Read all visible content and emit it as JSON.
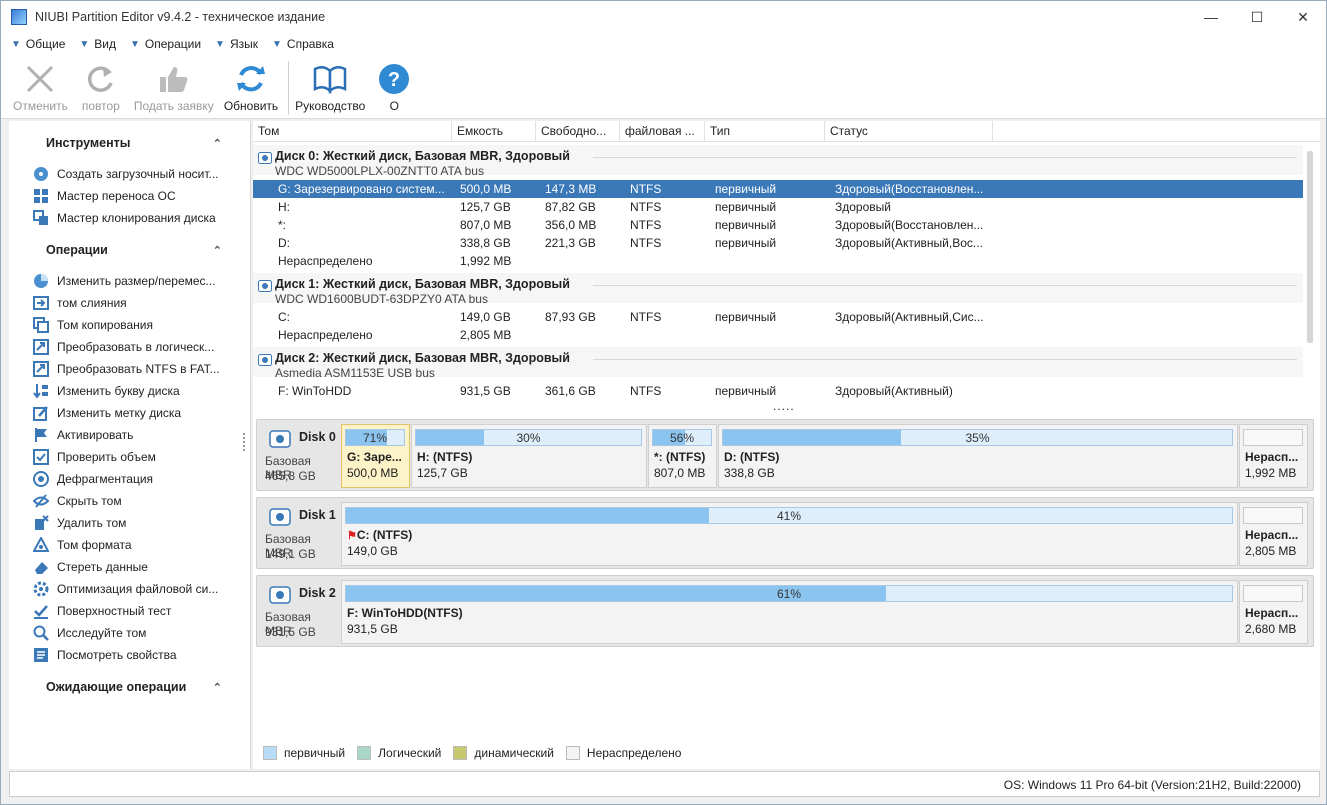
{
  "window": {
    "title": "NIUBI Partition Editor v9.4.2 - техническое издание"
  },
  "menu": [
    "Общие",
    "Вид",
    "Операции",
    "Язык",
    "Справка"
  ],
  "toolbar": {
    "undo": "Отменить",
    "redo": "повтор",
    "apply": "Подать заявку",
    "refresh": "Обновить",
    "manual": "Руководство",
    "about": "О"
  },
  "sidebar": {
    "tools_title": "Инструменты",
    "tools": [
      "Создать загрузочный носит...",
      "Мастер переноса ОС",
      "Мастер клонирования диска"
    ],
    "ops_title": "Операции",
    "ops": [
      "Изменить размер/перемес...",
      "том слияния",
      "Том копирования",
      "Преобразовать в логическ...",
      "Преобразовать NTFS в FAT...",
      "Изменить букву диска",
      "Изменить метку диска",
      "Активировать",
      "Проверить объем",
      "Дефрагментация",
      "Скрыть том",
      "Удалить том",
      "Том формата",
      "Стереть данные",
      "Оптимизация файловой си...",
      "Поверхностный тест",
      "Исследуйте том",
      "Посмотреть свойства"
    ],
    "pending_title": "Ожидающие операции"
  },
  "table": {
    "headers": [
      "Том",
      "Емкость",
      "Свободно...",
      "файловая ...",
      "Тип",
      "Статус"
    ],
    "disks": [
      {
        "title": "Диск 0: Жесткий диск, Базовая MBR, Здоровый",
        "model": "WDC WD5000LPLX-00ZNTT0 ATA bus"
      },
      {
        "title": "Диск 1: Жесткий диск, Базовая MBR, Здоровый",
        "model": "WDC WD1600BUDT-63DPZY0 ATA bus"
      },
      {
        "title": "Диск 2: Жесткий диск, Базовая MBR, Здоровый",
        "model": "Asmedia ASM1153E USB bus"
      }
    ],
    "rows": [
      {
        "vol": "G: Зарезервировано систем...",
        "cap": "500,0 MB",
        "free": "147,3 MB",
        "fs": "NTFS",
        "type": "первичный",
        "status": "Здоровый(Восстановлен..."
      },
      {
        "vol": "H:",
        "cap": "125,7 GB",
        "free": "87,82 GB",
        "fs": "NTFS",
        "type": "первичный",
        "status": "Здоровый"
      },
      {
        "vol": "*:",
        "cap": "807,0 MB",
        "free": "356,0 MB",
        "fs": "NTFS",
        "type": "первичный",
        "status": "Здоровый(Восстановлен..."
      },
      {
        "vol": "D:",
        "cap": "338,8 GB",
        "free": "221,3 GB",
        "fs": "NTFS",
        "type": "первичный",
        "status": "Здоровый(Активный,Вос..."
      },
      {
        "vol": "Нераспределено",
        "cap": "1,992 MB",
        "free": "",
        "fs": "",
        "type": "",
        "status": ""
      },
      {
        "vol": "C:",
        "cap": "149,0 GB",
        "free": "87,93 GB",
        "fs": "NTFS",
        "type": "первичный",
        "status": "Здоровый(Активный,Сис..."
      },
      {
        "vol": "Нераспределено",
        "cap": "2,805 MB",
        "free": "",
        "fs": "",
        "type": "",
        "status": ""
      },
      {
        "vol": "F: WinToHDD",
        "cap": "931,5 GB",
        "free": "361,6 GB",
        "fs": "NTFS",
        "type": "первичный",
        "status": "Здоровый(Активный)"
      }
    ],
    "more": "....."
  },
  "diskmap": [
    {
      "name": "Disk 0",
      "type": "Базовая MBR",
      "size": "465,8 GB",
      "parts": [
        {
          "pct": "71%",
          "fill": 0.71,
          "name": "G: Заре...",
          "size": "500,0 MB"
        },
        {
          "pct": "30%",
          "fill": 0.3,
          "name": "H: (NTFS)",
          "size": "125,7 GB"
        },
        {
          "pct": "56%",
          "fill": 0.56,
          "name": "*: (NTFS)",
          "size": "807,0 MB"
        },
        {
          "pct": "35%",
          "fill": 0.35,
          "name": "D: (NTFS)",
          "size": "338,8 GB"
        },
        {
          "pct": "",
          "fill": 0,
          "name": "Нерасп...",
          "size": "1,992 MB"
        }
      ]
    },
    {
      "name": "Disk 1",
      "type": "Базовая MBR",
      "size": "149,1 GB",
      "parts": [
        {
          "pct": "41%",
          "fill": 0.41,
          "name": "C: (NTFS)",
          "size": "149,0 GB"
        },
        {
          "pct": "",
          "fill": 0,
          "name": "Нерасп...",
          "size": "2,805 MB"
        }
      ]
    },
    {
      "name": "Disk 2",
      "type": "Базовая MBR",
      "size": "931,5 GB",
      "parts": [
        {
          "pct": "61%",
          "fill": 0.61,
          "name": "F: WinToHDD(NTFS)",
          "size": "931,5 GB"
        },
        {
          "pct": "",
          "fill": 0,
          "name": "Нерасп...",
          "size": "2,680 MB"
        }
      ]
    }
  ],
  "legend": [
    "первичный",
    "Логический",
    "динамический",
    "Нераспределено"
  ],
  "colors": {
    "primary": "#b9dcf6",
    "logical": "#a9d8c6",
    "dynamic": "#c8c870",
    "unallocated": "#f4f4f4",
    "selection": "#3a78b8"
  },
  "status": "OS: Windows 11 Pro 64-bit (Version:21H2, Build:22000)"
}
